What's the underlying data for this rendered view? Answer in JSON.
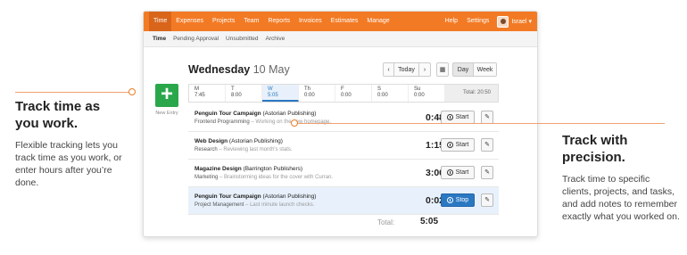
{
  "left_callout": {
    "title": "Track time as you work.",
    "desc": "Flexible tracking lets you track time as you work, or enter hours after you’re done."
  },
  "right_callout": {
    "title": "Track with precision.",
    "desc": "Track time to specific clients, projects, and tasks, and add notes to remember exactly what you worked on."
  },
  "nav": {
    "items": [
      "Time",
      "Expenses",
      "Projects",
      "Team",
      "Reports",
      "Invoices",
      "Estimates",
      "Manage"
    ],
    "help": "Help",
    "settings": "Settings",
    "user": "Israel"
  },
  "subnav": {
    "items": [
      "Time",
      "Pending Approval",
      "Unsubmitted",
      "Archive"
    ]
  },
  "new_entry": {
    "symbol": "+",
    "label": "New Entry"
  },
  "day": {
    "weekday": "Wednesday",
    "date": "10 May"
  },
  "controls": {
    "prev": "‹",
    "today": "Today",
    "next": "›",
    "calendar": "▦",
    "day": "Day",
    "week": "Week"
  },
  "week": {
    "days": [
      {
        "d": "M",
        "h": "7:45"
      },
      {
        "d": "T",
        "h": "8:00"
      },
      {
        "d": "W",
        "h": "5:05"
      },
      {
        "d": "Th",
        "h": "0:00"
      },
      {
        "d": "F",
        "h": "0:00"
      },
      {
        "d": "S",
        "h": "0:00"
      },
      {
        "d": "Su",
        "h": "0:00"
      }
    ],
    "total": "Total: 20:50"
  },
  "entries": [
    {
      "project": "Penguin Tour Campaign",
      "client": "(Astorian Publishing)",
      "task": "Frontend Programming",
      "note": "Working on the new homepage.",
      "time": "0:48",
      "action": "Start"
    },
    {
      "project": "Web Design",
      "client": "(Astorian Publishing)",
      "task": "Research",
      "note": "Reviewing last month's stats.",
      "time": "1:15",
      "action": "Start"
    },
    {
      "project": "Magazine Design",
      "client": "(Barrington Publishers)",
      "task": "Marketing",
      "note": "Brainstorming ideas for the cover with Curran.",
      "time": "3:00",
      "action": "Start"
    },
    {
      "project": "Penguin Tour Campaign",
      "client": "(Astorian Publishing)",
      "task": "Project Management",
      "note": "Last minute launch checks.",
      "time": "0:02",
      "action": "Stop"
    }
  ],
  "total": {
    "label": "Total:",
    "value": "5:05"
  },
  "colors": {
    "brand_orange": "#f37a24",
    "new_entry_green": "#2aa74b",
    "stop_blue": "#2b78c2"
  }
}
